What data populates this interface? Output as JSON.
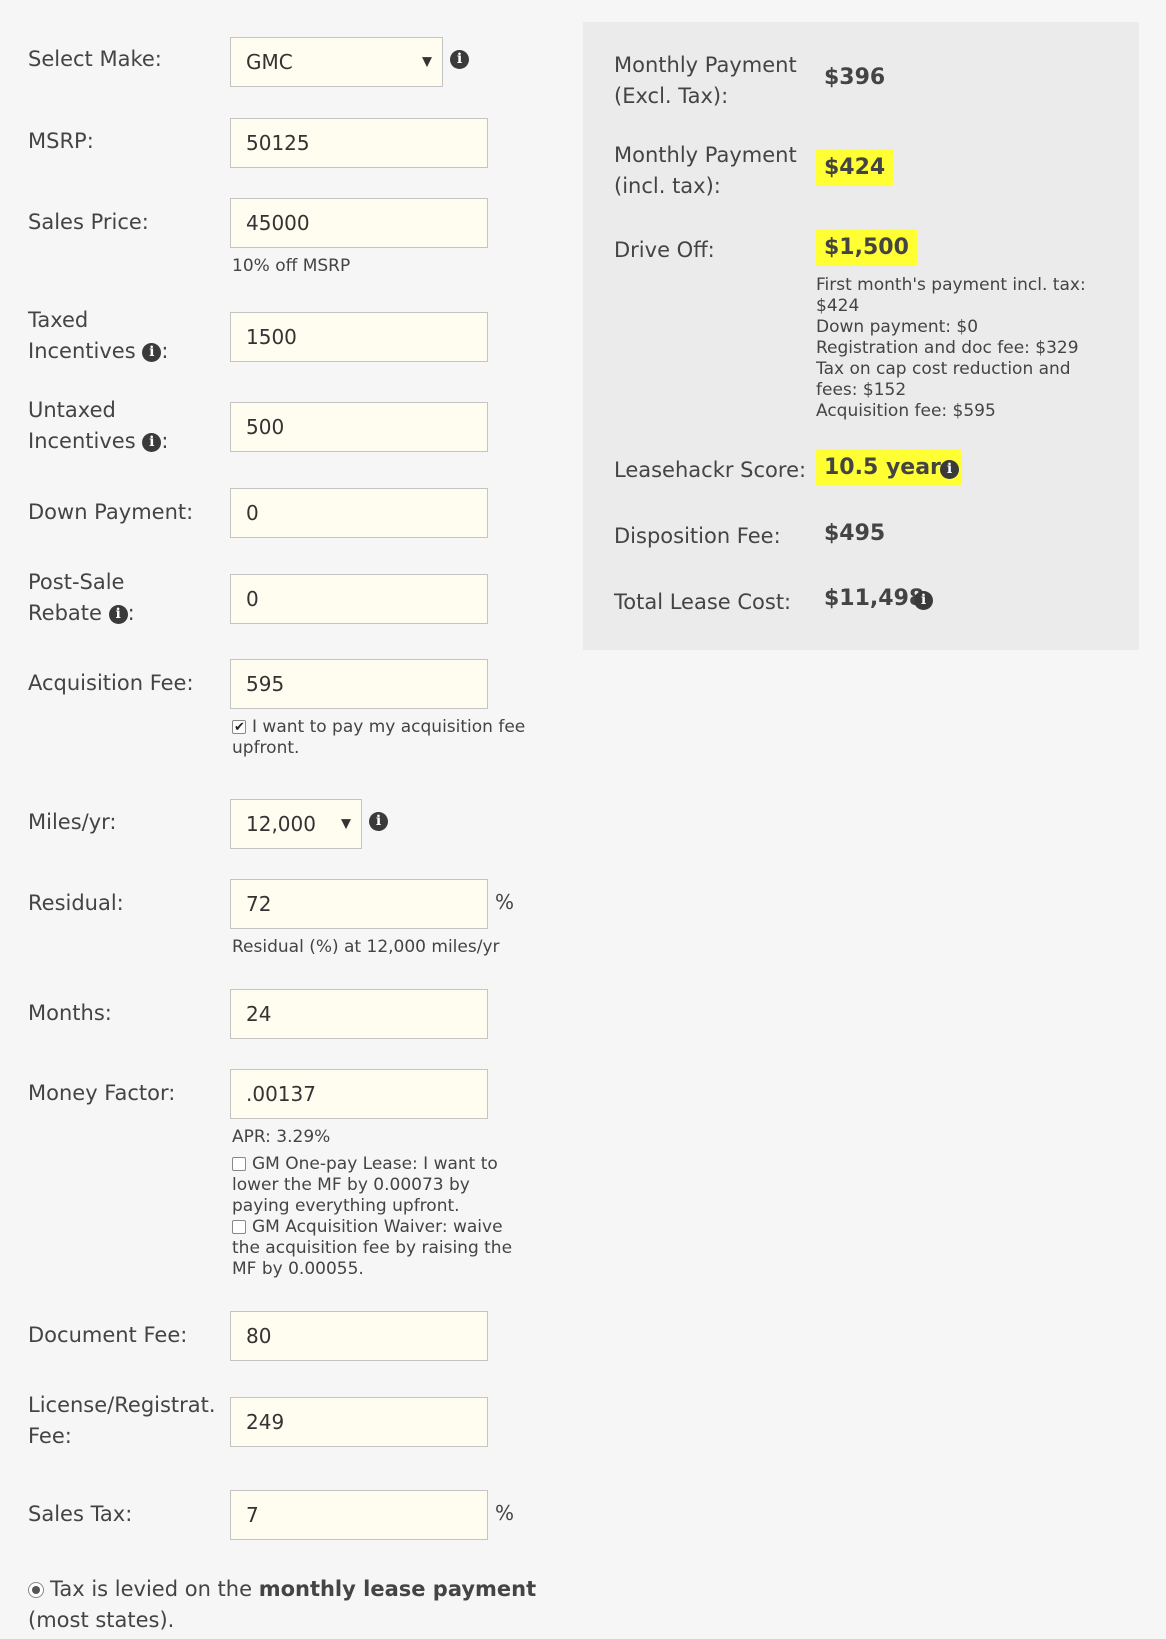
{
  "form": {
    "make": {
      "label": "Select Make:",
      "value": "GMC"
    },
    "msrp": {
      "label": "MSRP:",
      "value": "50125"
    },
    "sales_price": {
      "label": "Sales Price:",
      "value": "45000",
      "help": "10% off MSRP"
    },
    "taxed_incentives": {
      "label_line1": "Taxed",
      "label_line2": "Incentives",
      "value": "1500"
    },
    "untaxed_incentives": {
      "label_line1": "Untaxed",
      "label_line2": "Incentives",
      "value": "500"
    },
    "down_payment": {
      "label": "Down Payment:",
      "value": "0"
    },
    "post_sale_rebate": {
      "label_line1": "Post-Sale",
      "label_line2": "Rebate",
      "value": "0"
    },
    "acquisition_fee": {
      "label": "Acquisition Fee:",
      "value": "595",
      "checkbox_label": "I want to pay my acquisition fee upfront.",
      "checked": true
    },
    "miles": {
      "label": "Miles/yr:",
      "value": "12,000"
    },
    "residual": {
      "label": "Residual:",
      "value": "72",
      "unit": "%",
      "help": "Residual (%) at 12,000 miles/yr"
    },
    "months": {
      "label": "Months:",
      "value": "24"
    },
    "money_factor": {
      "label": "Money Factor:",
      "value": ".00137",
      "apr": "APR: 3.29%",
      "one_pay_label": "GM One-pay Lease: I want to lower the MF by 0.00073 by paying everything upfront.",
      "waiver_label": "GM Acquisition Waiver: waive the acquisition fee by raising the MF by 0.00055."
    },
    "document_fee": {
      "label": "Document Fee:",
      "value": "80"
    },
    "license_fee": {
      "label_line1": "License/Registrat.",
      "label_line2": "Fee:",
      "value": "249"
    },
    "sales_tax": {
      "label": "Sales Tax:",
      "value": "7",
      "unit": "%"
    },
    "tax_option": {
      "prefix": "Tax is levied on the ",
      "bold": "monthly lease payment",
      "suffix": "(most states)."
    }
  },
  "results": {
    "monthly_excl": {
      "label_line1": "Monthly Payment",
      "label_line2": "(Excl. Tax):",
      "value": "$396"
    },
    "monthly_incl": {
      "label_line1": "Monthly Payment",
      "label_line2": "(incl. tax):",
      "value": "$424"
    },
    "drive_off": {
      "label": "Drive Off:",
      "value": "$1,500",
      "breakdown": [
        "First month's payment incl. tax:",
        "$424",
        "Down payment: $0",
        "Registration and doc fee: $329",
        "Tax on cap cost reduction and",
        "fees: $152",
        "Acquisition fee: $595"
      ]
    },
    "score": {
      "label": "Leasehackr Score:",
      "value": "10.5 years"
    },
    "disposition": {
      "label": "Disposition Fee:",
      "value": "$495"
    },
    "total": {
      "label": "Total Lease Cost:",
      "value": "$11,498"
    }
  },
  "icons": {
    "info": "i"
  },
  "colors": {
    "highlight": "#ffff33",
    "panel": "#ebebeb",
    "input_bg": "#fffdf0"
  }
}
